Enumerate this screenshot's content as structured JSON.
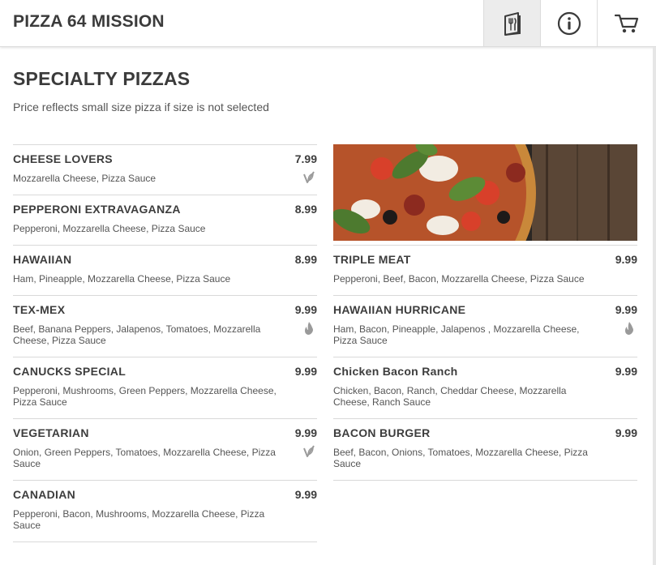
{
  "header": {
    "title": "PIZZA 64 MISSION",
    "buttons": [
      {
        "icon": "menu-book-icon",
        "active": true
      },
      {
        "icon": "info-icon"
      },
      {
        "icon": "cart-icon"
      }
    ]
  },
  "section": {
    "title": "SPECIALTY PIZZAS",
    "subtitle": "Price reflects small size pizza if size is not selected"
  },
  "left_items": [
    {
      "name": "CHEESE LOVERS",
      "price": "7.99",
      "desc": "Mozzarella Cheese, Pizza Sauce",
      "badge": "vegetarian-icon"
    },
    {
      "name": "PEPPERONI EXTRAVAGANZA",
      "price": "8.99",
      "desc": "Pepperoni, Mozzarella Cheese, Pizza Sauce"
    },
    {
      "name": "HAWAIIAN",
      "price": "8.99",
      "desc": "Ham, Pineapple, Mozzarella Cheese, Pizza Sauce"
    },
    {
      "name": "TEX-MEX",
      "price": "9.99",
      "desc": "Beef, Banana Peppers, Jalapenos, Tomatoes, Mozzarella Cheese, Pizza Sauce",
      "badge": "spicy-icon"
    },
    {
      "name": "CANUCKS SPECIAL",
      "price": "9.99",
      "desc": "Pepperoni, Mushrooms, Green Peppers, Mozzarella Cheese, Pizza Sauce"
    },
    {
      "name": "VEGETARIAN",
      "price": "9.99",
      "desc": "Onion, Green Peppers, Tomatoes, Mozzarella Cheese, Pizza Sauce",
      "badge": "vegetarian-icon"
    },
    {
      "name": "CANADIAN",
      "price": "9.99",
      "desc": "Pepperoni, Bacon, Mushrooms, Mozzarella Cheese, Pizza Sauce"
    }
  ],
  "right_items": [
    {
      "name": "TRIPLE MEAT",
      "price": "9.99",
      "desc": "Pepperoni, Beef, Bacon, Mozzarella Cheese, Pizza Sauce"
    },
    {
      "name": "HAWAIIAN HURRICANE",
      "price": "9.99",
      "desc": "Ham, Bacon, Pineapple, Jalapenos , Mozzarella Cheese, Pizza Sauce",
      "badge": "spicy-icon"
    },
    {
      "name": "Chicken Bacon Ranch",
      "price": "9.99",
      "desc": "Chicken, Bacon, Ranch, Cheddar Cheese, Mozzarella Cheese, Ranch Sauce"
    },
    {
      "name": "BACON BURGER",
      "price": "9.99",
      "desc": "Beef, Bacon, Onions, Tomatoes, Mozzarella Cheese, Pizza Sauce"
    }
  ],
  "colors": {
    "text": "#3d3d3d",
    "muted": "#555555",
    "divider": "#d9d9d9",
    "active_tab": "#ececec",
    "icon": "#9a9a9a"
  }
}
